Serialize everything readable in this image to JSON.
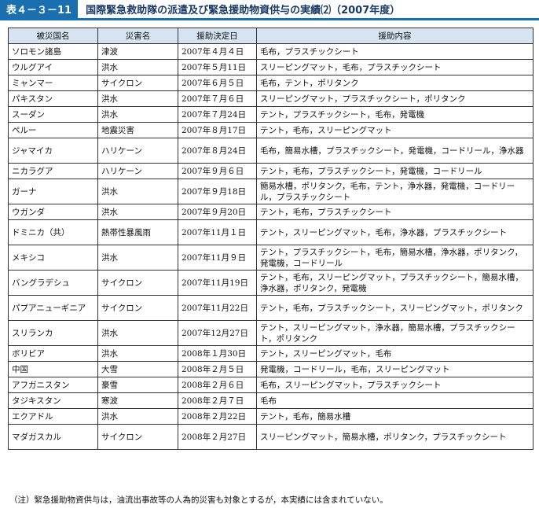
{
  "title": {
    "badge": "表４－３－11",
    "text": "国際緊急救助隊の派遣及び緊急援助物資供与の実績⑵（2007年度）"
  },
  "table": {
    "headers": [
      "被災国名",
      "災害名",
      "援助決定日",
      "援助内容"
    ],
    "rows": [
      {
        "country": "ソロモン諸島",
        "disaster": "津波",
        "date": "2007年４月４日",
        "aid": "毛布，プラスチックシート"
      },
      {
        "country": "ウルグアイ",
        "disaster": "洪水",
        "date": "2007年５月11日",
        "aid": "スリーピングマット，毛布，プラスチックシート"
      },
      {
        "country": "ミャンマー",
        "disaster": "サイクロン",
        "date": "2007年６月５日",
        "aid": "毛布，テント，ポリタンク"
      },
      {
        "country": "パキスタン",
        "disaster": "洪水",
        "date": "2007年７月６日",
        "aid": "スリーピングマット，プラスチックシート，ポリタンク"
      },
      {
        "country": "スーダン",
        "disaster": "洪水",
        "date": "2007年７月24日",
        "aid": "テント，プラスチックシート，毛布，発電機"
      },
      {
        "country": "ペルー",
        "disaster": "地震災害",
        "date": "2007年８月17日",
        "aid": "テント，毛布，スリーピングマット"
      },
      {
        "country": "ジャマイカ",
        "disaster": "ハリケーン",
        "date": "2007年８月24日",
        "aid": "毛布，簡易水槽，プラスチックシート，発電機，コードリール，浄水器"
      },
      {
        "country": "ニカラグア",
        "disaster": "ハリケーン",
        "date": "2007年９月６日",
        "aid": "テント，毛布，プラスチックシート，発電機，コードリール"
      },
      {
        "country": "ガーナ",
        "disaster": "洪水",
        "date": "2007年９月18日",
        "aid": "簡易水槽，ポリタンク，毛布，テント，浄水器，発電機，コードリール，プラスチックシート"
      },
      {
        "country": "ウガンダ",
        "disaster": "洪水",
        "date": "2007年９月20日",
        "aid": "テント，毛布，プラスチックシート"
      },
      {
        "country": "ドミニカ（共）",
        "disaster": "熱帯性暴風雨",
        "date": "2007年11月１日",
        "aid": "テント，スリーピングマット，毛布，浄水器，プラスチックシート"
      },
      {
        "country": "メキシコ",
        "disaster": "洪水",
        "date": "2007年11月９日",
        "aid": "テント，プラスチックシート，毛布，簡易水槽，浄水器，ポリタンク，発電機，コードリール"
      },
      {
        "country": "バングラデシュ",
        "disaster": "サイクロン",
        "date": "2007年11月19日",
        "aid": "テント，毛布，スリーピングマット，プラスチックシート，簡易水槽，浄水器，ポリタンク，発電機"
      },
      {
        "country": "パプアニューギニア",
        "disaster": "サイクロン",
        "date": "2007年11月22日",
        "aid": "テント，毛布，プラスチックシート，スリーピングマット，ポリタンク"
      },
      {
        "country": "スリランカ",
        "disaster": "洪水",
        "date": "2007年12月27日",
        "aid": "テント，スリーピングマット，浄水器，簡易水槽，プラスチックシート，ポリタンク"
      },
      {
        "country": "ボリビア",
        "disaster": "洪水",
        "date": "2008年１月30日",
        "aid": "テント，スリーピングマット，毛布"
      },
      {
        "country": "中国",
        "disaster": "大雪",
        "date": "2008年２月５日",
        "aid": "発電機，コードリール，毛布，スリーピングマット"
      },
      {
        "country": "アフガニスタン",
        "disaster": "豪雪",
        "date": "2008年２月６日",
        "aid": "毛布，スリーピングマット，プラスチックシート"
      },
      {
        "country": "タジキスタン",
        "disaster": "寒波",
        "date": "2008年２月７日",
        "aid": "毛布"
      },
      {
        "country": "エクアドル",
        "disaster": "洪水",
        "date": "2008年２月22日",
        "aid": "テント，毛布，簡易水槽"
      },
      {
        "country": "マダガスカル",
        "disaster": "サイクロン",
        "date": "2008年２月27日",
        "aid": "スリーピングマット，簡易水槽，ポリタンク，プラスチックシート"
      }
    ]
  },
  "note": "（注）緊急援助物資供与は，油流出事故等の人為的災害も対象とするが，本実績には含まれていない。"
}
